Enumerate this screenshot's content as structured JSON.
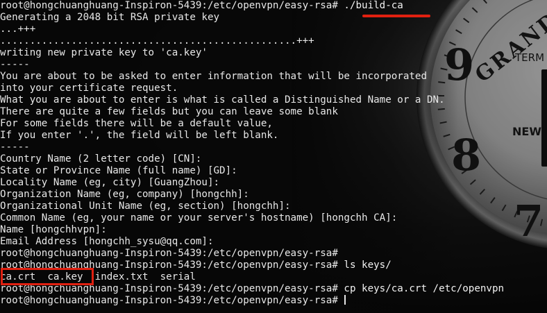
{
  "terminal": {
    "prompt": "root@hongchuanghuang-Inspiron-5439:/etc/openvpn/easy-rsa#",
    "lines": [
      {
        "cmd": " ./build-ca"
      },
      {
        "text": "Generating a 2048 bit RSA private key"
      },
      {
        "text": "...+++"
      },
      {
        "text": "..................................................+++"
      },
      {
        "text": "writing new private key to 'ca.key'"
      },
      {
        "text": "-----"
      },
      {
        "text": "You are about to be asked to enter information that will be incorporated"
      },
      {
        "text": "into your certificate request."
      },
      {
        "text": "What you are about to enter is what is called a Distinguished Name or a DN."
      },
      {
        "text": "There are quite a few fields but you can leave some blank"
      },
      {
        "text": "For some fields there will be a default value,"
      },
      {
        "text": "If you enter '.', the field will be left blank."
      },
      {
        "text": "-----"
      },
      {
        "text": "Country Name (2 letter code) [CN]:"
      },
      {
        "text": "State or Province Name (full name) [GD]:"
      },
      {
        "text": "Locality Name (eg, city) [GuangZhou]:"
      },
      {
        "text": "Organization Name (eg, company) [hongchh]:"
      },
      {
        "text": "Organizational Unit Name (eg, section) [hongchh]:"
      },
      {
        "text": "Common Name (eg, your name or your server's hostname) [hongchh CA]:"
      },
      {
        "text": "Name [hongchhvpn]:"
      },
      {
        "text": "Email Address [hongchh_sysu@qq.com]:"
      },
      {
        "cmd": ""
      },
      {
        "cmd": " ls keys/"
      },
      {
        "text": "ca.crt  ca.key  index.txt  serial"
      },
      {
        "cmd": " cp keys/ca.crt /etc/openvpn"
      },
      {
        "cmd": " ",
        "cursor": true
      }
    ]
  },
  "background": {
    "clock_text": [
      "GRAND",
      "TERM",
      "NEW"
    ],
    "clock_numerals": [
      "7",
      "8",
      "9"
    ]
  },
  "annotations": {
    "accent_color": "#e02010"
  }
}
